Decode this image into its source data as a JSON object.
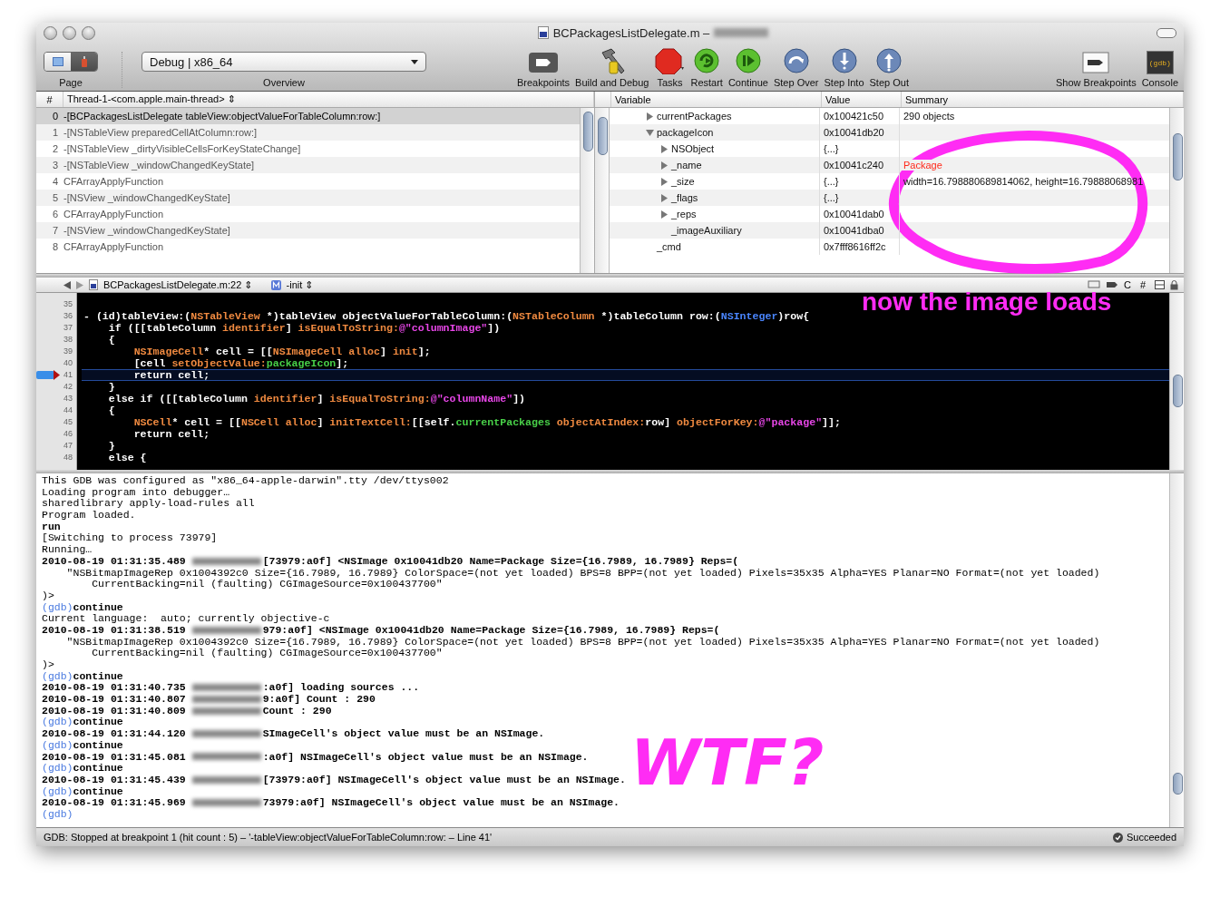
{
  "window": {
    "title": "BCPackagesListDelegate.m – "
  },
  "toolbar": {
    "page": {
      "label": "Page",
      "segments": [
        {
          "selected": false
        },
        {
          "selected": true
        }
      ]
    },
    "scheme": {
      "value": "Debug | x86_64",
      "label": "Overview"
    },
    "buttons": [
      {
        "kind": "breakpoints",
        "label": "Breakpoints"
      },
      {
        "kind": "build",
        "label": "Build and Debug"
      },
      {
        "kind": "tasks",
        "label": "Tasks"
      },
      {
        "kind": "restart",
        "label": "Restart"
      },
      {
        "kind": "continue",
        "label": "Continue"
      },
      {
        "kind": "step_over",
        "label": "Step Over"
      },
      {
        "kind": "step_into",
        "label": "Step Into"
      },
      {
        "kind": "step_out",
        "label": "Step Out"
      }
    ],
    "right_buttons": [
      {
        "kind": "show_breakpoints",
        "label": "Show Breakpoints"
      },
      {
        "kind": "console",
        "label": "Console",
        "icon_text": "(gdb)"
      }
    ]
  },
  "stack": {
    "column_1": "#",
    "thread": "Thread-1-<com.apple.main-thread> ⇕",
    "frames": [
      {
        "index": "0",
        "name": "-[BCPackagesListDelegate tableView:objectValueForTableColumn:row:]",
        "selected": true
      },
      {
        "index": "1",
        "name": "-[NSTableView preparedCellAtColumn:row:]",
        "selected": false
      },
      {
        "index": "2",
        "name": "-[NSTableView _dirtyVisibleCellsForKeyStateChange]",
        "selected": false
      },
      {
        "index": "3",
        "name": "-[NSTableView _windowChangedKeyState]",
        "selected": false
      },
      {
        "index": "4",
        "name": "CFArrayApplyFunction",
        "selected": false
      },
      {
        "index": "5",
        "name": "-[NSView _windowChangedKeyState]",
        "selected": false
      },
      {
        "index": "6",
        "name": "CFArrayApplyFunction",
        "selected": false
      },
      {
        "index": "7",
        "name": "-[NSView _windowChangedKeyState]",
        "selected": false
      },
      {
        "index": "8",
        "name": "CFArrayApplyFunction",
        "selected": false
      }
    ]
  },
  "variables": {
    "columns": [
      "Variable",
      "Value",
      "Summary"
    ],
    "rows": [
      {
        "name": "currentPackages",
        "value": "0x100421c50",
        "summary": "290 objects",
        "kind": "collapsed"
      },
      {
        "name": "packageIcon",
        "value": "0x10041db20",
        "kind": "expanded",
        "children": [
          {
            "name": "NSObject",
            "value": "{...}",
            "kind": "collapsed"
          },
          {
            "name": "_name",
            "value": "0x10041c240",
            "summary": "Package",
            "color": "#ff2a1a",
            "kind": "collapsed"
          },
          {
            "name": "_size",
            "value": "{...}",
            "summary": "width=16.798880689814062, height=16.79888068981",
            "kind": "collapsed"
          },
          {
            "name": "_flags",
            "value": "{...}",
            "kind": "collapsed"
          },
          {
            "name": "_reps",
            "value": "0x10041dab0",
            "kind": "collapsed"
          },
          {
            "name": "_imageAuxiliary",
            "value": "0x10041dba0",
            "kind": "leaf"
          }
        ]
      },
      {
        "name": "_cmd",
        "value": "0x7fff8616ff2c",
        "kind": "leaf"
      }
    ]
  },
  "editor": {
    "nav": {
      "file": "BCPackagesListDelegate.m:22 ⇕",
      "symbol": "-init ⇕",
      "menus": [
        "C",
        "#"
      ]
    },
    "lines": [
      {
        "number": "35",
        "current": false
      },
      {
        "number": "36",
        "current": false,
        "tokens": [
          {
            "text": "- (id)tableView:(",
            "kind": "plain"
          },
          {
            "text": "NSTableView",
            "kind": "type"
          },
          {
            "text": " *)tableView objectValueForTableColumn:(",
            "kind": "plain"
          },
          {
            "text": "NSTableColumn",
            "kind": "type"
          },
          {
            "text": " *)tableColumn row:(",
            "kind": "plain"
          },
          {
            "text": "NSInteger",
            "kind": "builtin"
          },
          {
            "text": ")row{",
            "kind": "plain"
          }
        ]
      },
      {
        "number": "37",
        "current": false,
        "tokens": [
          {
            "text": "    if ([[tableColumn ",
            "kind": "plain"
          },
          {
            "text": "identifier",
            "kind": "method"
          },
          {
            "text": "] ",
            "kind": "plain"
          },
          {
            "text": "isEqualToString:",
            "kind": "method"
          },
          {
            "text": "@\"columnImage\"",
            "kind": "string"
          },
          {
            "text": "])",
            "kind": "plain"
          }
        ]
      },
      {
        "number": "38",
        "current": false,
        "tokens": [
          {
            "text": "    {",
            "kind": "plain"
          }
        ]
      },
      {
        "number": "39",
        "current": false,
        "tokens": [
          {
            "text": "        NSImageCell",
            "kind": "type"
          },
          {
            "text": "* cell = [[",
            "kind": "plain"
          },
          {
            "text": "NSImageCell",
            "kind": "type"
          },
          {
            "text": " alloc",
            "kind": "method"
          },
          {
            "text": "] ",
            "kind": "plain"
          },
          {
            "text": "init",
            "kind": "method"
          },
          {
            "text": "];",
            "kind": "plain"
          }
        ]
      },
      {
        "number": "40",
        "current": false,
        "tokens": [
          {
            "text": "        [cell ",
            "kind": "plain"
          },
          {
            "text": "setObjectValue:",
            "kind": "method"
          },
          {
            "text": "packageIcon",
            "kind": "variable"
          },
          {
            "text": "];",
            "kind": "plain"
          }
        ]
      },
      {
        "number": "41",
        "current": true,
        "tokens": [
          {
            "text": "        return cell;",
            "kind": "plain"
          }
        ]
      },
      {
        "number": "42",
        "current": false,
        "tokens": [
          {
            "text": "    }",
            "kind": "plain"
          }
        ]
      },
      {
        "number": "43",
        "current": false,
        "tokens": [
          {
            "text": "    else if ([[tableColumn ",
            "kind": "plain"
          },
          {
            "text": "identifier",
            "kind": "method"
          },
          {
            "text": "] ",
            "kind": "plain"
          },
          {
            "text": "isEqualToString:",
            "kind": "method"
          },
          {
            "text": "@\"columnName\"",
            "kind": "string"
          },
          {
            "text": "])",
            "kind": "plain"
          }
        ]
      },
      {
        "number": "44",
        "current": false,
        "tokens": [
          {
            "text": "    {",
            "kind": "plain"
          }
        ]
      },
      {
        "number": "45",
        "current": false,
        "tokens": [
          {
            "text": "        NSCell",
            "kind": "type"
          },
          {
            "text": "* cell = [[",
            "kind": "plain"
          },
          {
            "text": "NSCell",
            "kind": "type"
          },
          {
            "text": " alloc",
            "kind": "method"
          },
          {
            "text": "] ",
            "kind": "plain"
          },
          {
            "text": "initTextCell:",
            "kind": "method"
          },
          {
            "text": "[[self.",
            "kind": "plain"
          },
          {
            "text": "currentPackages",
            "kind": "variable"
          },
          {
            "text": " objectAtIndex:",
            "kind": "method"
          },
          {
            "text": "row] ",
            "kind": "plain"
          },
          {
            "text": "objectForKey:",
            "kind": "method"
          },
          {
            "text": "@\"package\"",
            "kind": "string"
          },
          {
            "text": "]];",
            "kind": "plain"
          }
        ]
      },
      {
        "number": "46",
        "current": false,
        "tokens": [
          {
            "text": "        return cell;",
            "kind": "plain"
          }
        ]
      },
      {
        "number": "47",
        "current": false,
        "tokens": [
          {
            "text": "    }",
            "kind": "plain"
          }
        ]
      },
      {
        "number": "48",
        "current": false,
        "tokens": [
          {
            "text": "    else {",
            "kind": "plain"
          }
        ]
      }
    ]
  },
  "console": {
    "lines": [
      {
        "kind": "output",
        "text": "This GDB was configured as \"x86_64-apple-darwin\".tty /dev/ttys002"
      },
      {
        "kind": "output",
        "text": "Loading program into debugger…"
      },
      {
        "kind": "output",
        "text": "sharedlibrary apply-load-rules all"
      },
      {
        "kind": "output",
        "text": "Program loaded."
      },
      {
        "kind": "command",
        "text": "run"
      },
      {
        "kind": "output",
        "text": "[Switching to process 73979]"
      },
      {
        "kind": "output",
        "text": "Running…"
      },
      {
        "kind": "log",
        "time": "2010-08-19 01:31:35.489",
        "text": "[73979:a0f] <NSImage 0x10041db20 Name=Package Size={16.7989, 16.7989} Reps=("
      },
      {
        "kind": "output",
        "text": "    \"NSBitmapImageRep 0x1004392c0 Size={16.7989, 16.7989} ColorSpace=(not yet loaded) BPS=8 BPP=(not yet loaded) Pixels=35x35 Alpha=YES Planar=NO Format=(not yet loaded)"
      },
      {
        "kind": "output",
        "text": "        CurrentBacking=nil (faulting) CGImageSource=0x100437700\""
      },
      {
        "kind": "output",
        "text": ")>"
      },
      {
        "kind": "prompt",
        "prompt": "(gdb)",
        "text": "continue"
      },
      {
        "kind": "output",
        "text": "Current language:  auto; currently objective-c"
      },
      {
        "kind": "log",
        "time": "2010-08-19 01:31:38.519",
        "text": "979:a0f] <NSImage 0x10041db20 Name=Package Size={16.7989, 16.7989} Reps=("
      },
      {
        "kind": "output",
        "text": "    \"NSBitmapImageRep 0x1004392c0 Size={16.7989, 16.7989} ColorSpace=(not yet loaded) BPS=8 BPP=(not yet loaded) Pixels=35x35 Alpha=YES Planar=NO Format=(not yet loaded)"
      },
      {
        "kind": "output",
        "text": "        CurrentBacking=nil (faulting) CGImageSource=0x100437700\""
      },
      {
        "kind": "output",
        "text": ")>"
      },
      {
        "kind": "prompt",
        "prompt": "(gdb)",
        "text": "continue"
      },
      {
        "kind": "log",
        "time": "2010-08-19 01:31:40.735",
        "text": ":a0f] loading sources ..."
      },
      {
        "kind": "log",
        "time": "2010-08-19 01:31:40.807",
        "text": "9:a0f] Count : 290"
      },
      {
        "kind": "log",
        "time": "2010-08-19 01:31:40.809",
        "text": "Count : 290"
      },
      {
        "kind": "prompt",
        "prompt": "(gdb)",
        "text": "continue"
      },
      {
        "kind": "log",
        "time": "2010-08-19 01:31:44.120",
        "text": "SImageCell's object value must be an NSImage."
      },
      {
        "kind": "prompt",
        "prompt": "(gdb)",
        "text": "continue"
      },
      {
        "kind": "log",
        "time": "2010-08-19 01:31:45.081",
        "text": ":a0f] NSImageCell's object value must be an NSImage."
      },
      {
        "kind": "prompt",
        "prompt": "(gdb)",
        "text": "continue"
      },
      {
        "kind": "log",
        "time": "2010-08-19 01:31:45.439",
        "text": "[73979:a0f] NSImageCell's object value must be an NSImage."
      },
      {
        "kind": "prompt",
        "prompt": "(gdb)",
        "text": "continue"
      },
      {
        "kind": "log",
        "time": "2010-08-19 01:31:45.969",
        "text": "73979:a0f] NSImageCell's object value must be an NSImage."
      },
      {
        "kind": "prompt",
        "prompt": "(gdb)"
      }
    ]
  },
  "status_bar": {
    "text": "GDB: Stopped at breakpoint 1 (hit count : 5) – '-tableView:objectValueForTableColumn:row: – Line 41'",
    "result": "Succeeded"
  },
  "annotations": [
    {
      "kind": "caption",
      "text": "now the image loads"
    },
    {
      "kind": "scrawl",
      "text": "WTF?"
    },
    {
      "kind": "circle"
    }
  ]
}
